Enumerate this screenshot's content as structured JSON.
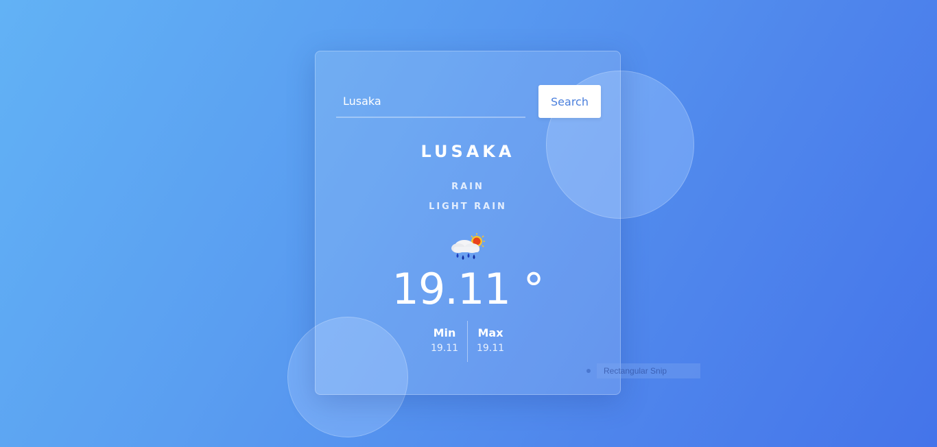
{
  "search": {
    "value": "Lusaka",
    "button_label": "Search"
  },
  "weather": {
    "city": "LUSAKA",
    "main": "RAIN",
    "description": "LIGHT RAIN",
    "icon": "rain-cloud-sun-icon",
    "temperature": "19.11 °",
    "min_label": "Min",
    "min_value": "19.11",
    "max_label": "Max",
    "max_value": "19.11"
  },
  "overlay": {
    "snip_label": "Rectangular Snip"
  },
  "colors": {
    "background_start": "#62b2f5",
    "background_end": "#4474ea",
    "button_text": "#4a7fdc"
  }
}
